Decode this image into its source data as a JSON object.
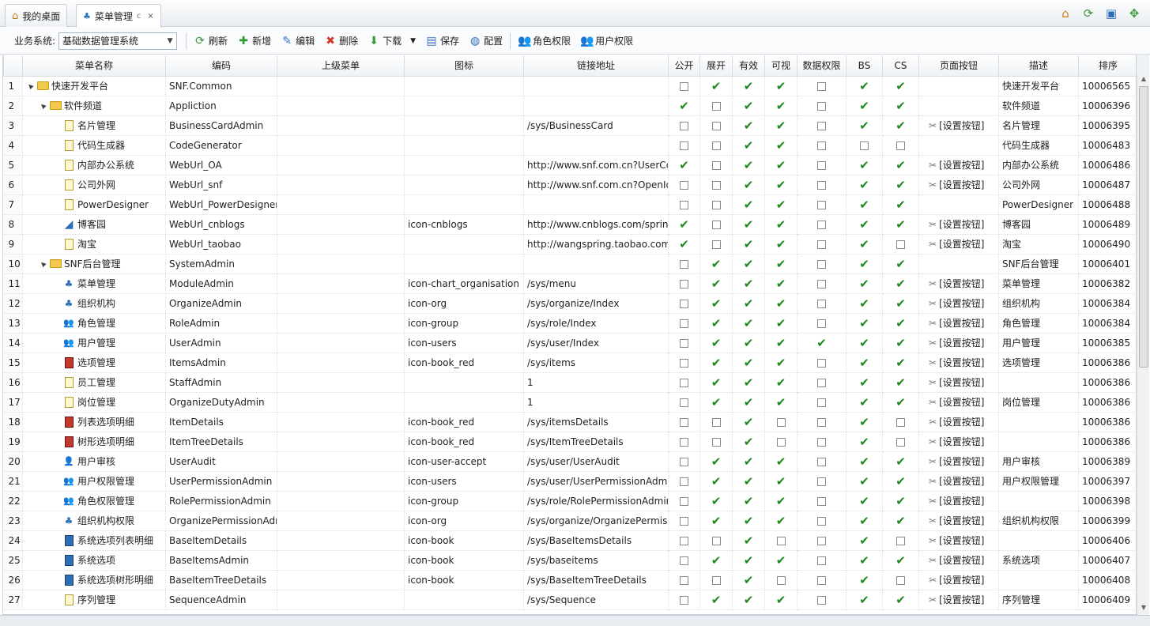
{
  "tabs": [
    {
      "label": "我的桌面",
      "icon": "home-icon"
    },
    {
      "label": "菜单管理",
      "icon": "org-chart-icon",
      "refresh": "c",
      "close": "×"
    }
  ],
  "toolbar": {
    "system_label": "业务系统:",
    "system_value": "基础数据管理系统",
    "refresh": "刷新",
    "add": "新增",
    "edit": "编辑",
    "delete": "删除",
    "download": "下载",
    "save": "保存",
    "config": "配置",
    "role_perm": "角色权限",
    "user_perm": "用户权限"
  },
  "columns": [
    "",
    "菜单名称",
    "编码",
    "上级菜单",
    "图标",
    "链接地址",
    "公开",
    "展开",
    "有效",
    "可视",
    "数据权限",
    "BS",
    "CS",
    "页面按钮",
    "描述",
    "排序"
  ],
  "set_button_label": "[设置按钮]",
  "rows": [
    {
      "n": "1",
      "level": 0,
      "tri": "▲",
      "icon": "folder-icon",
      "name": "快速开发平台",
      "code": "SNF.Common",
      "iconcls": "",
      "url": "",
      "f": [
        0,
        1,
        1,
        1,
        0,
        1,
        1
      ],
      "btn": false,
      "desc": "快速开发平台",
      "sort": "10006565"
    },
    {
      "n": "2",
      "level": 1,
      "tri": "▲",
      "icon": "folder-icon",
      "name": "软件频道",
      "code": "Appliction",
      "iconcls": "",
      "url": "",
      "f": [
        1,
        0,
        1,
        1,
        0,
        1,
        1
      ],
      "btn": false,
      "desc": "软件频道",
      "sort": "10006396"
    },
    {
      "n": "3",
      "level": 2,
      "icon": "doc-icon",
      "name": "名片管理",
      "code": "BusinessCardAdmin",
      "iconcls": "",
      "url": "/sys/BusinessCard",
      "f": [
        0,
        0,
        1,
        1,
        0,
        1,
        1
      ],
      "btn": true,
      "desc": "名片管理",
      "sort": "10006395"
    },
    {
      "n": "4",
      "level": 2,
      "icon": "doc-icon",
      "name": "代码生成器",
      "code": "CodeGenerator",
      "iconcls": "",
      "url": "",
      "f": [
        0,
        0,
        1,
        1,
        0,
        0,
        0
      ],
      "btn": false,
      "desc": "代码生成器",
      "sort": "10006483"
    },
    {
      "n": "5",
      "level": 2,
      "icon": "doc-icon",
      "name": "内部办公系统",
      "code": "WebUrl_OA",
      "iconcls": "",
      "url": "http://www.snf.com.cn?UserCod",
      "f": [
        1,
        0,
        1,
        1,
        0,
        1,
        1
      ],
      "btn": true,
      "desc": "内部办公系统",
      "sort": "10006486"
    },
    {
      "n": "6",
      "level": 2,
      "icon": "doc-icon",
      "name": "公司外网",
      "code": "WebUrl_snf",
      "iconcls": "",
      "url": "http://www.snf.com.cn?OpenId={",
      "f": [
        0,
        0,
        1,
        1,
        0,
        1,
        1
      ],
      "btn": true,
      "desc": "公司外网",
      "sort": "10006487"
    },
    {
      "n": "7",
      "level": 2,
      "icon": "doc-icon",
      "name": "PowerDesigner",
      "code": "WebUrl_PowerDesigner",
      "iconcls": "",
      "url": "",
      "f": [
        0,
        0,
        1,
        1,
        0,
        1,
        1
      ],
      "btn": false,
      "desc": "PowerDesigner",
      "sort": "10006488"
    },
    {
      "n": "8",
      "level": 2,
      "icon": "cnblogs-icon",
      "name": "博客园",
      "code": "WebUrl_cnblogs",
      "iconcls": "icon-cnblogs",
      "url": "http://www.cnblogs.com/spring_",
      "f": [
        1,
        0,
        1,
        1,
        0,
        1,
        1
      ],
      "btn": true,
      "desc": "博客园",
      "sort": "10006489"
    },
    {
      "n": "9",
      "level": 2,
      "icon": "doc-icon",
      "name": "淘宝",
      "code": "WebUrl_taobao",
      "iconcls": "",
      "url": "http://wangspring.taobao.com/",
      "f": [
        1,
        0,
        1,
        1,
        0,
        1,
        0
      ],
      "btn": true,
      "desc": "淘宝",
      "sort": "10006490"
    },
    {
      "n": "10",
      "level": 1,
      "tri": "▲",
      "icon": "folder-icon",
      "name": "SNF后台管理",
      "code": "SystemAdmin",
      "iconcls": "",
      "url": "",
      "f": [
        0,
        1,
        1,
        1,
        0,
        1,
        1
      ],
      "btn": false,
      "desc": "SNF后台管理",
      "sort": "10006401"
    },
    {
      "n": "11",
      "level": 2,
      "icon": "org-chart-icon",
      "name": "菜单管理",
      "code": "ModuleAdmin",
      "iconcls": "icon-chart_organisation",
      "url": "/sys/menu",
      "f": [
        0,
        1,
        1,
        1,
        0,
        1,
        1
      ],
      "btn": true,
      "desc": "菜单管理",
      "sort": "10006382"
    },
    {
      "n": "12",
      "level": 2,
      "icon": "org-icon",
      "name": "组织机构",
      "code": "OrganizeAdmin",
      "iconcls": "icon-org",
      "url": "/sys/organize/Index",
      "f": [
        0,
        1,
        1,
        1,
        0,
        1,
        1
      ],
      "btn": true,
      "desc": "组织机构",
      "sort": "10006384"
    },
    {
      "n": "13",
      "level": 2,
      "icon": "group-icon",
      "name": "角色管理",
      "code": "RoleAdmin",
      "iconcls": "icon-group",
      "url": "/sys/role/Index",
      "f": [
        0,
        1,
        1,
        1,
        0,
        1,
        1
      ],
      "btn": true,
      "desc": "角色管理",
      "sort": "10006384"
    },
    {
      "n": "14",
      "level": 2,
      "icon": "users-icon",
      "name": "用户管理",
      "code": "UserAdmin",
      "iconcls": "icon-users",
      "url": "/sys/user/Index",
      "f": [
        0,
        1,
        1,
        1,
        1,
        1,
        1
      ],
      "btn": true,
      "desc": "用户管理",
      "sort": "10006385"
    },
    {
      "n": "15",
      "level": 2,
      "icon": "book-red-icon",
      "name": "选项管理",
      "code": "ItemsAdmin",
      "iconcls": "icon-book_red",
      "url": "/sys/items",
      "f": [
        0,
        1,
        1,
        1,
        0,
        1,
        1
      ],
      "btn": true,
      "desc": "选项管理",
      "sort": "10006386"
    },
    {
      "n": "16",
      "level": 2,
      "icon": "doc-icon",
      "name": "员工管理",
      "code": "StaffAdmin",
      "iconcls": "",
      "url": "1",
      "f": [
        0,
        1,
        1,
        1,
        0,
        1,
        1
      ],
      "btn": true,
      "desc": "",
      "sort": "10006386"
    },
    {
      "n": "17",
      "level": 2,
      "icon": "doc-icon",
      "name": "岗位管理",
      "code": "OrganizeDutyAdmin",
      "iconcls": "",
      "url": "1",
      "f": [
        0,
        1,
        1,
        1,
        0,
        1,
        1
      ],
      "btn": true,
      "desc": "岗位管理",
      "sort": "10006386"
    },
    {
      "n": "18",
      "level": 2,
      "icon": "book-red-icon",
      "name": "列表选项明细",
      "code": "ItemDetails",
      "iconcls": "icon-book_red",
      "url": "/sys/itemsDetails",
      "f": [
        0,
        0,
        1,
        0,
        0,
        1,
        0
      ],
      "btn": true,
      "desc": "",
      "sort": "10006386"
    },
    {
      "n": "19",
      "level": 2,
      "icon": "book-red-icon",
      "name": "树形选项明细",
      "code": "ItemTreeDetails",
      "iconcls": "icon-book_red",
      "url": "/sys/ItemTreeDetails",
      "f": [
        0,
        0,
        1,
        0,
        0,
        1,
        0
      ],
      "btn": true,
      "desc": "",
      "sort": "10006386"
    },
    {
      "n": "20",
      "level": 2,
      "icon": "user-accept-icon",
      "name": "用户审核",
      "code": "UserAudit",
      "iconcls": "icon-user-accept",
      "url": "/sys/user/UserAudit",
      "f": [
        0,
        1,
        1,
        1,
        0,
        1,
        1
      ],
      "btn": true,
      "desc": "用户审核",
      "sort": "10006389"
    },
    {
      "n": "21",
      "level": 2,
      "icon": "users-icon",
      "name": "用户权限管理",
      "code": "UserPermissionAdmin",
      "iconcls": "icon-users",
      "url": "/sys/user/UserPermissionAdmir",
      "f": [
        0,
        1,
        1,
        1,
        0,
        1,
        1
      ],
      "btn": true,
      "desc": "用户权限管理",
      "sort": "10006397"
    },
    {
      "n": "22",
      "level": 2,
      "icon": "group-icon",
      "name": "角色权限管理",
      "code": "RolePermissionAdmin",
      "iconcls": "icon-group",
      "url": "/sys/role/RolePermissionAdmin",
      "f": [
        0,
        1,
        1,
        1,
        0,
        1,
        1
      ],
      "btn": true,
      "desc": "",
      "sort": "10006398"
    },
    {
      "n": "23",
      "level": 2,
      "icon": "org-icon",
      "name": "组织机构权限",
      "code": "OrganizePermissionAdm",
      "iconcls": "icon-org",
      "url": "/sys/organize/OrganizePermissi",
      "f": [
        0,
        1,
        1,
        1,
        0,
        1,
        1
      ],
      "btn": true,
      "desc": "组织机构权限",
      "sort": "10006399"
    },
    {
      "n": "24",
      "level": 2,
      "icon": "book-blue-icon",
      "name": "系统选项列表明细",
      "code": "BaseItemDetails",
      "iconcls": "icon-book",
      "url": "/sys/BaseItemsDetails",
      "f": [
        0,
        0,
        1,
        0,
        0,
        1,
        0
      ],
      "btn": true,
      "desc": "",
      "sort": "10006406"
    },
    {
      "n": "25",
      "level": 2,
      "icon": "book-blue-icon",
      "name": "系统选项",
      "code": "BaseItemsAdmin",
      "iconcls": "icon-book",
      "url": "/sys/baseitems",
      "f": [
        0,
        1,
        1,
        1,
        0,
        1,
        1
      ],
      "btn": true,
      "desc": "系统选项",
      "sort": "10006407"
    },
    {
      "n": "26",
      "level": 2,
      "icon": "book-blue-icon",
      "name": "系统选项树形明细",
      "code": "BaseItemTreeDetails",
      "iconcls": "icon-book",
      "url": "/sys/BaseItemTreeDetails",
      "f": [
        0,
        0,
        1,
        0,
        0,
        1,
        0
      ],
      "btn": true,
      "desc": "",
      "sort": "10006408"
    },
    {
      "n": "27",
      "level": 2,
      "icon": "doc-icon",
      "name": "序列管理",
      "code": "SequenceAdmin",
      "iconcls": "",
      "url": "/sys/Sequence",
      "f": [
        0,
        1,
        1,
        1,
        0,
        1,
        1
      ],
      "btn": true,
      "desc": "序列管理",
      "sort": "10006409"
    }
  ],
  "colors": {
    "check": "#1e8a1e",
    "book_red": "#c0392b",
    "book_blue": "#2d6fb7",
    "folder": "#f3c94a"
  }
}
